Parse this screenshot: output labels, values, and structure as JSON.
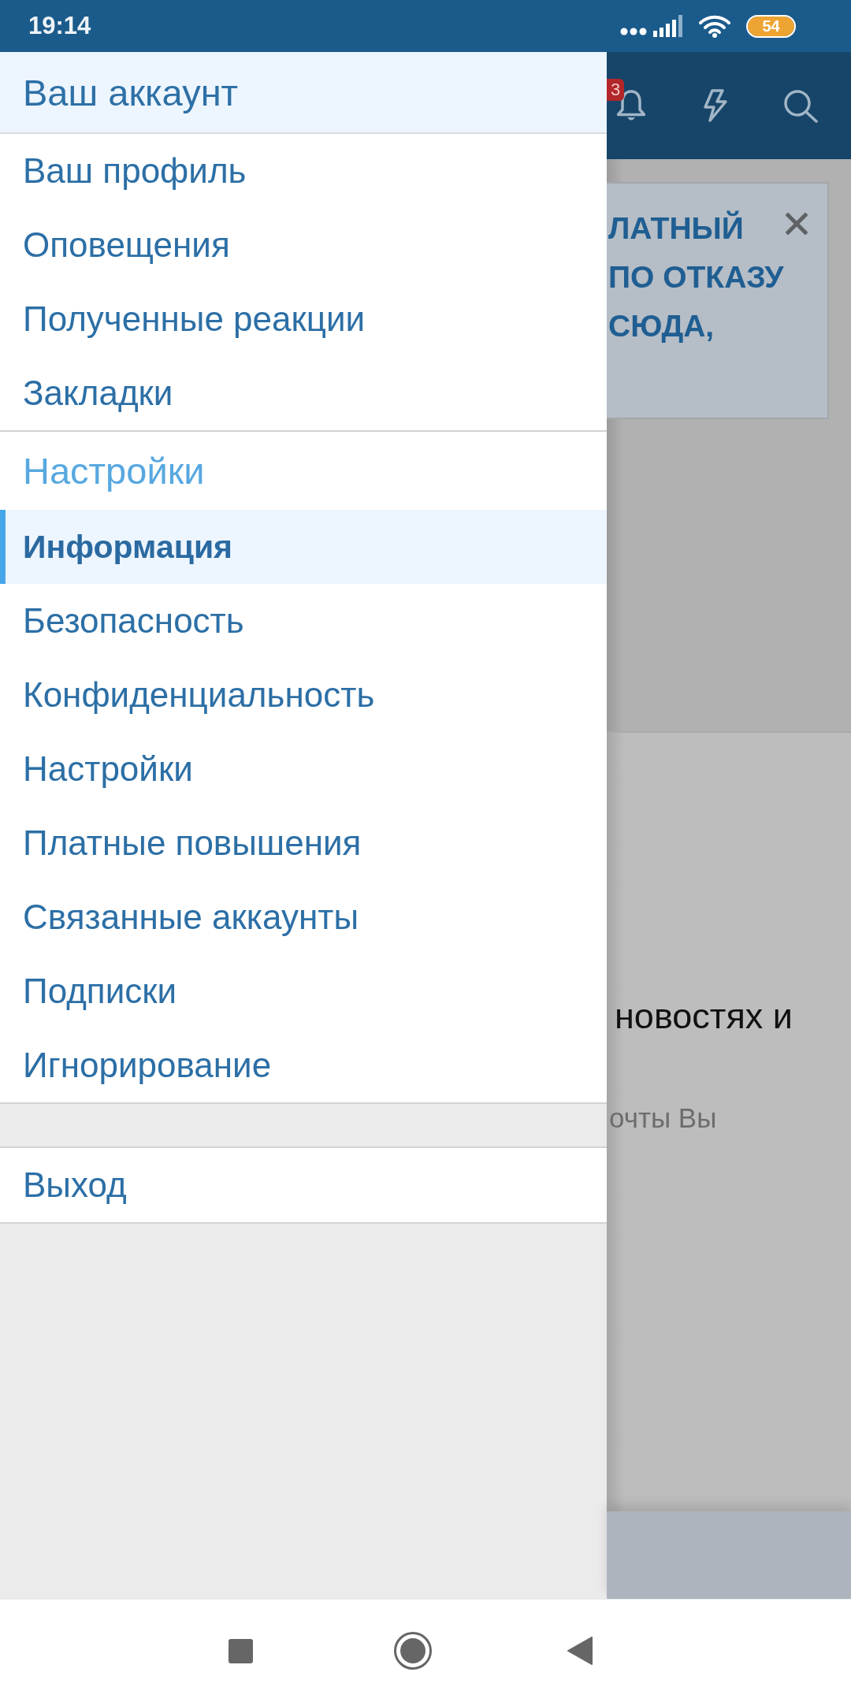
{
  "status_bar": {
    "time": "19:14",
    "battery": "54"
  },
  "drawer": {
    "title": "Ваш аккаунт",
    "account_items": [
      {
        "label": "Ваш профиль",
        "selected": false
      },
      {
        "label": "Оповещения",
        "selected": false
      },
      {
        "label": "Полученные реакции",
        "selected": false
      },
      {
        "label": "Закладки",
        "selected": false
      }
    ],
    "settings_heading": "Настройки",
    "settings_items": [
      {
        "label": "Информация",
        "selected": true
      },
      {
        "label": "Безопасность",
        "selected": false
      },
      {
        "label": "Конфиденциальность",
        "selected": false
      },
      {
        "label": "Настройки",
        "selected": false
      },
      {
        "label": "Платные повышения",
        "selected": false
      },
      {
        "label": "Связанные аккаунты",
        "selected": false
      },
      {
        "label": "Подписки",
        "selected": false
      },
      {
        "label": "Игнорирование",
        "selected": false
      }
    ],
    "footer_items": [
      {
        "label": "Выход",
        "selected": false
      }
    ]
  },
  "page": {
    "notification_count": "3",
    "banner_lines": [
      "ЛАТНЫЙ",
      "ПО ОТКАЗУ",
      "СЮДА,"
    ],
    "body_text": "новостях и",
    "note_text": "очты Вы"
  }
}
